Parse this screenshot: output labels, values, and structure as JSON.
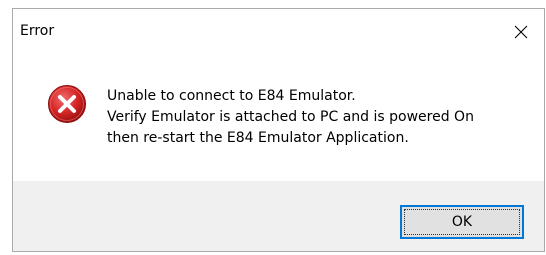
{
  "dialog": {
    "title": "Error",
    "message_lines": [
      "Unable to connect to E84 Emulator.",
      "Verify Emulator is attached to PC and is powered On",
      "then re-start the E84 Emulator Application."
    ],
    "ok_label": "OK",
    "icon": "error-icon",
    "close_icon": "close-icon"
  },
  "colors": {
    "accent": "#0078d7",
    "error_red": "#d42525",
    "footer_bg": "#f0f0f0",
    "button_bg": "#e1e1e1"
  }
}
